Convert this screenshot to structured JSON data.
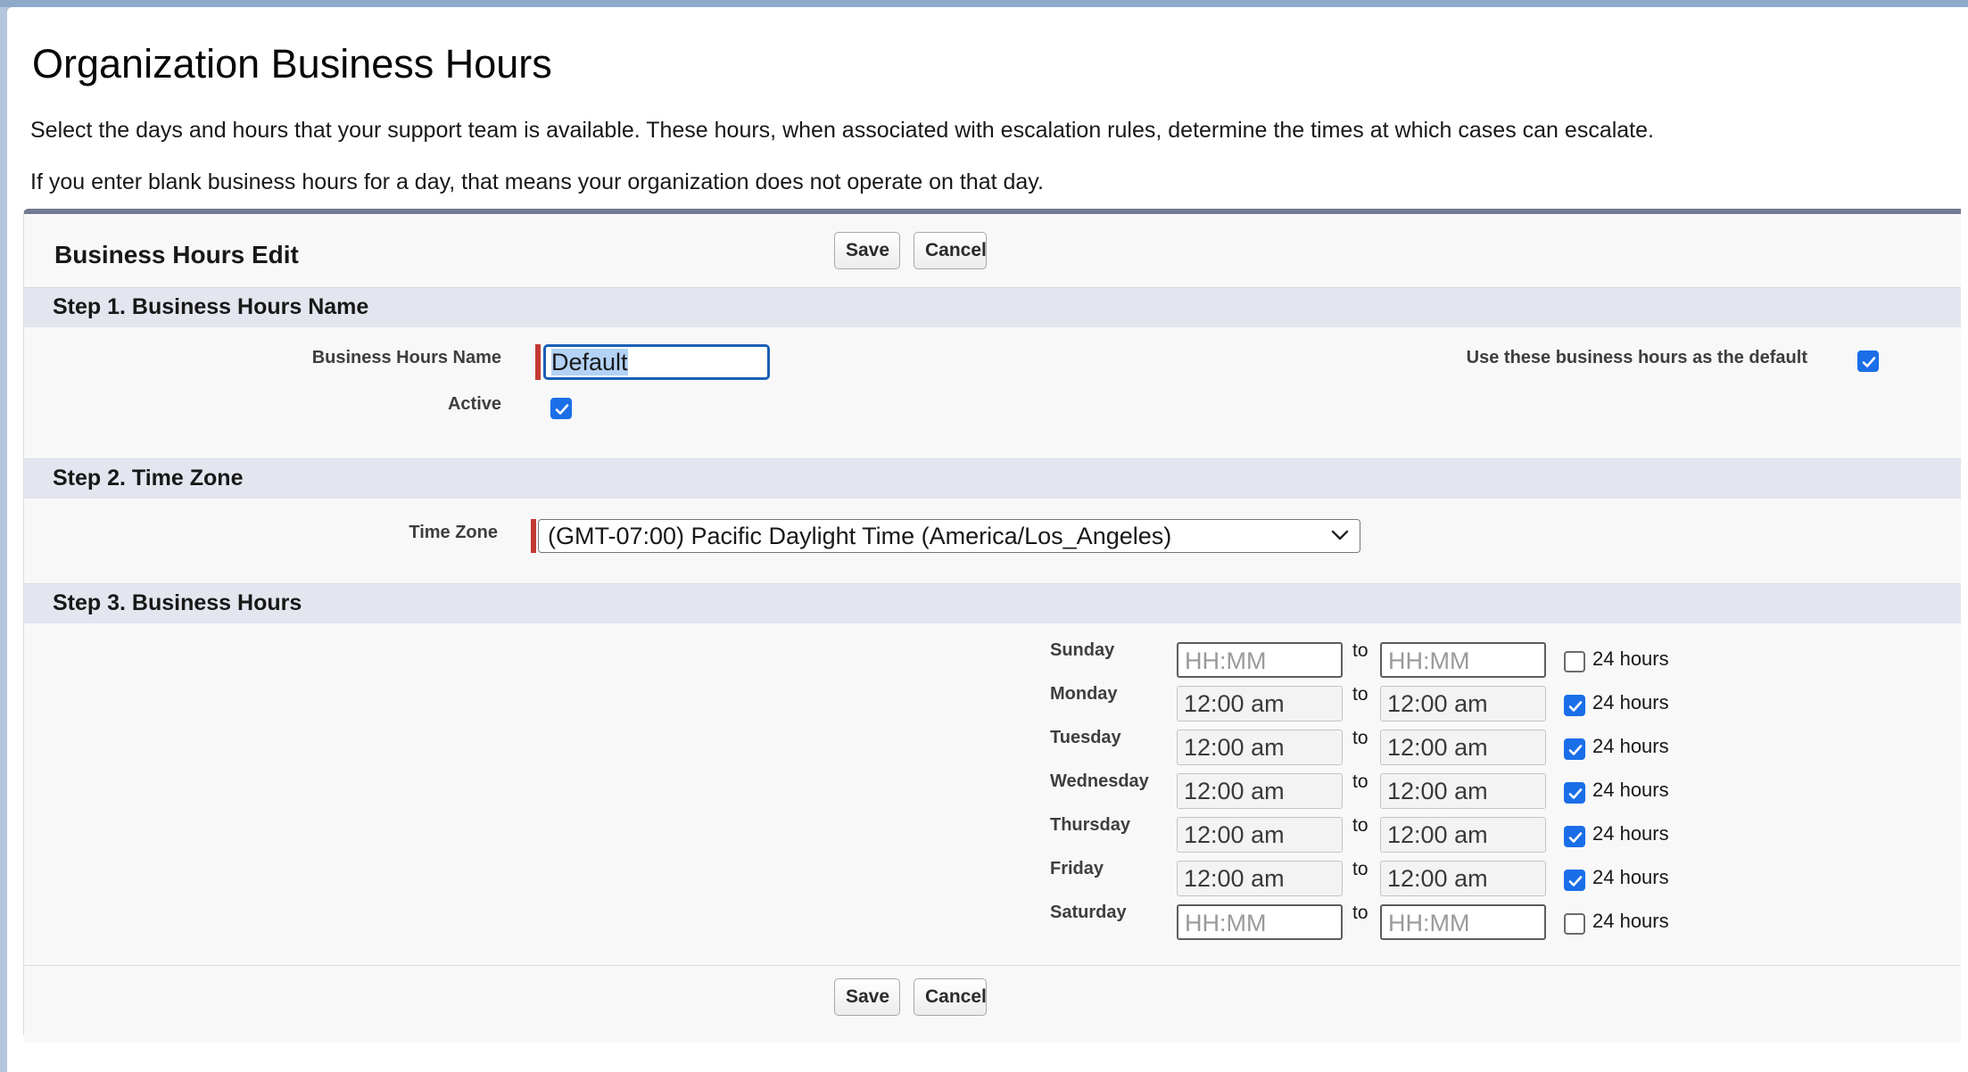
{
  "page": {
    "title": "Organization Business Hours",
    "description_1": "Select the days and hours that your support team is available. These hours, when associated with escalation rules, determine the times at which cases can escalate.",
    "description_2": "If you enter blank business hours for a day, that means your organization does not operate on that day."
  },
  "panel": {
    "title": "Business Hours Edit",
    "save_label": "Save",
    "cancel_label": "Cancel"
  },
  "step1": {
    "heading": "Step 1. Business Hours Name",
    "name_label": "Business Hours Name",
    "name_value": "Default",
    "active_label": "Active",
    "active_checked": true,
    "default_label": "Use these business hours as the default",
    "default_checked": true
  },
  "step2": {
    "heading": "Step 2. Time Zone",
    "timezone_label": "Time Zone",
    "timezone_value": "(GMT-07:00) Pacific Daylight Time (America/Los_Angeles)"
  },
  "step3": {
    "heading": "Step 3. Business Hours",
    "to_label": "to",
    "all_day_label": "24 hours",
    "placeholder": "HH:MM",
    "days": [
      {
        "name": "Sunday",
        "start": "",
        "end": "",
        "all_day": false
      },
      {
        "name": "Monday",
        "start": "12:00 am",
        "end": "12:00 am",
        "all_day": true
      },
      {
        "name": "Tuesday",
        "start": "12:00 am",
        "end": "12:00 am",
        "all_day": true
      },
      {
        "name": "Wednesday",
        "start": "12:00 am",
        "end": "12:00 am",
        "all_day": true
      },
      {
        "name": "Thursday",
        "start": "12:00 am",
        "end": "12:00 am",
        "all_day": true
      },
      {
        "name": "Friday",
        "start": "12:00 am",
        "end": "12:00 am",
        "all_day": true
      },
      {
        "name": "Saturday",
        "start": "",
        "end": "",
        "all_day": false
      }
    ]
  },
  "colors": {
    "accent": "#1a6ee8",
    "required": "#c23934",
    "section_bg": "#e3e6ef",
    "panel_border": "#727b92"
  }
}
